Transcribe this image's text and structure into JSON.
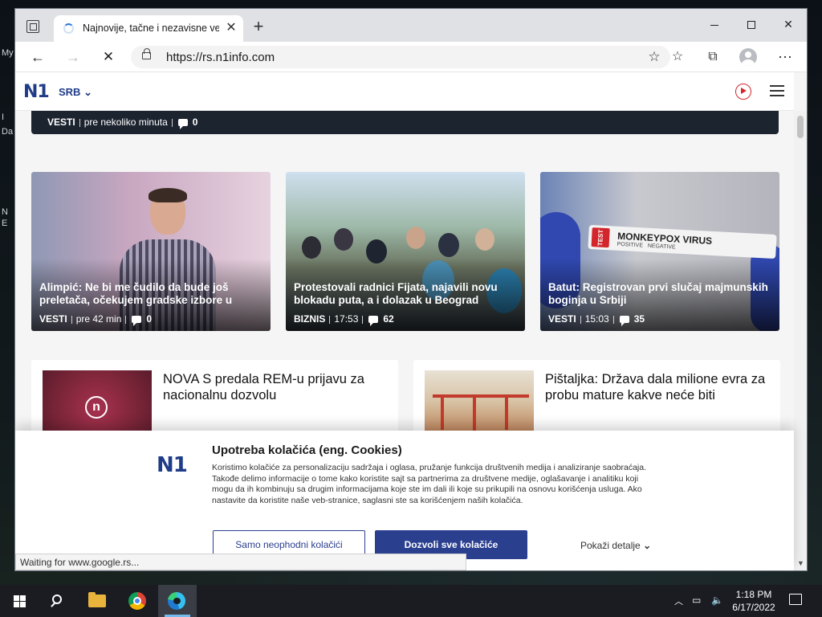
{
  "desktop": {
    "edge_labels": [
      "My",
      "I",
      "Da",
      "N",
      "E"
    ]
  },
  "browser": {
    "tab": {
      "title": "Najnovije, tačne i nezavisne vesti",
      "close_glyph": "✕"
    },
    "new_tab_glyph": "+",
    "address": {
      "url": "https://rs.n1info.com"
    },
    "status_text": "Waiting for www.google.rs..."
  },
  "site": {
    "logo": "N1",
    "region": "SRB",
    "top_strip": {
      "category": "VESTI",
      "time": "pre nekoliko minuta",
      "comments": "0"
    },
    "featured": [
      {
        "title": "Alimpić: Ne bi me čudilo da bude još preletača, očekujem gradske izbore u",
        "category": "VESTI",
        "time": "pre 42 min",
        "comments": "0"
      },
      {
        "title": "Protestovali radnici Fijata, najavili novu blokadu puta, a i dolazak u Beograd",
        "category": "BIZNIS",
        "time": "17:53",
        "comments": "62"
      },
      {
        "title": "Batut: Registrovan prvi slučaj majmunskih boginja u Srbiji",
        "category": "VESTI",
        "time": "15:03",
        "comments": "35",
        "image_label_main": "MONKEYPOX VIRUS",
        "image_label_sub": "POSITIVE   NEGATIVE",
        "image_cap_text": "TEST"
      }
    ],
    "list": [
      {
        "title": "NOVA S predala REM-u prijavu za nacionalnu dozvolu",
        "thumb_badge": "n"
      },
      {
        "title": "Pištaljka: Država dala milione evra za probu mature kakve neće biti"
      }
    ]
  },
  "cookie": {
    "logo": "N1",
    "title": "Upotreba kolačića (eng. Cookies)",
    "body": "Koristimo kolačiće za personalizaciju sadržaja i oglasa, pružanje funkcija društvenih medija i analiziranje saobraćaja. Takođe delimo informacije o tome kako koristite sajt sa partnerima za društvene medije, oglašavanje i analitiku koji mogu da ih kombinuju sa drugim informacijama koje ste im dali ili koje su prikupili na osnovu korišćenja usluga. Ako nastavite da koristite naše veb-stranice, saglasni ste sa korišćenjem naših kolačića.",
    "btn_necessary": "Samo neophodni kolačići",
    "btn_all": "Dozvoli sve kolačiće",
    "details": "Pokaži detalje"
  },
  "taskbar": {
    "time": "1:18 PM",
    "date": "6/17/2022"
  },
  "colors": {
    "brand": "#1f3c88",
    "accent_red": "#d3262c",
    "button_primary": "#2b3f8f"
  },
  "icons": [
    "tab-actions-icon",
    "loading-spinner-icon",
    "close-icon",
    "plus-icon",
    "back-icon",
    "forward-icon",
    "stop-icon",
    "lock-icon",
    "add-favorite-icon",
    "favorites-icon",
    "collections-icon",
    "profile-icon",
    "more-icon",
    "chevron-down-icon",
    "play-icon",
    "hamburger-menu-icon",
    "comment-icon",
    "windows-start-icon",
    "search-icon",
    "file-explorer-icon",
    "chrome-icon",
    "edge-icon",
    "network-icon",
    "volume-icon",
    "notification-icon"
  ]
}
